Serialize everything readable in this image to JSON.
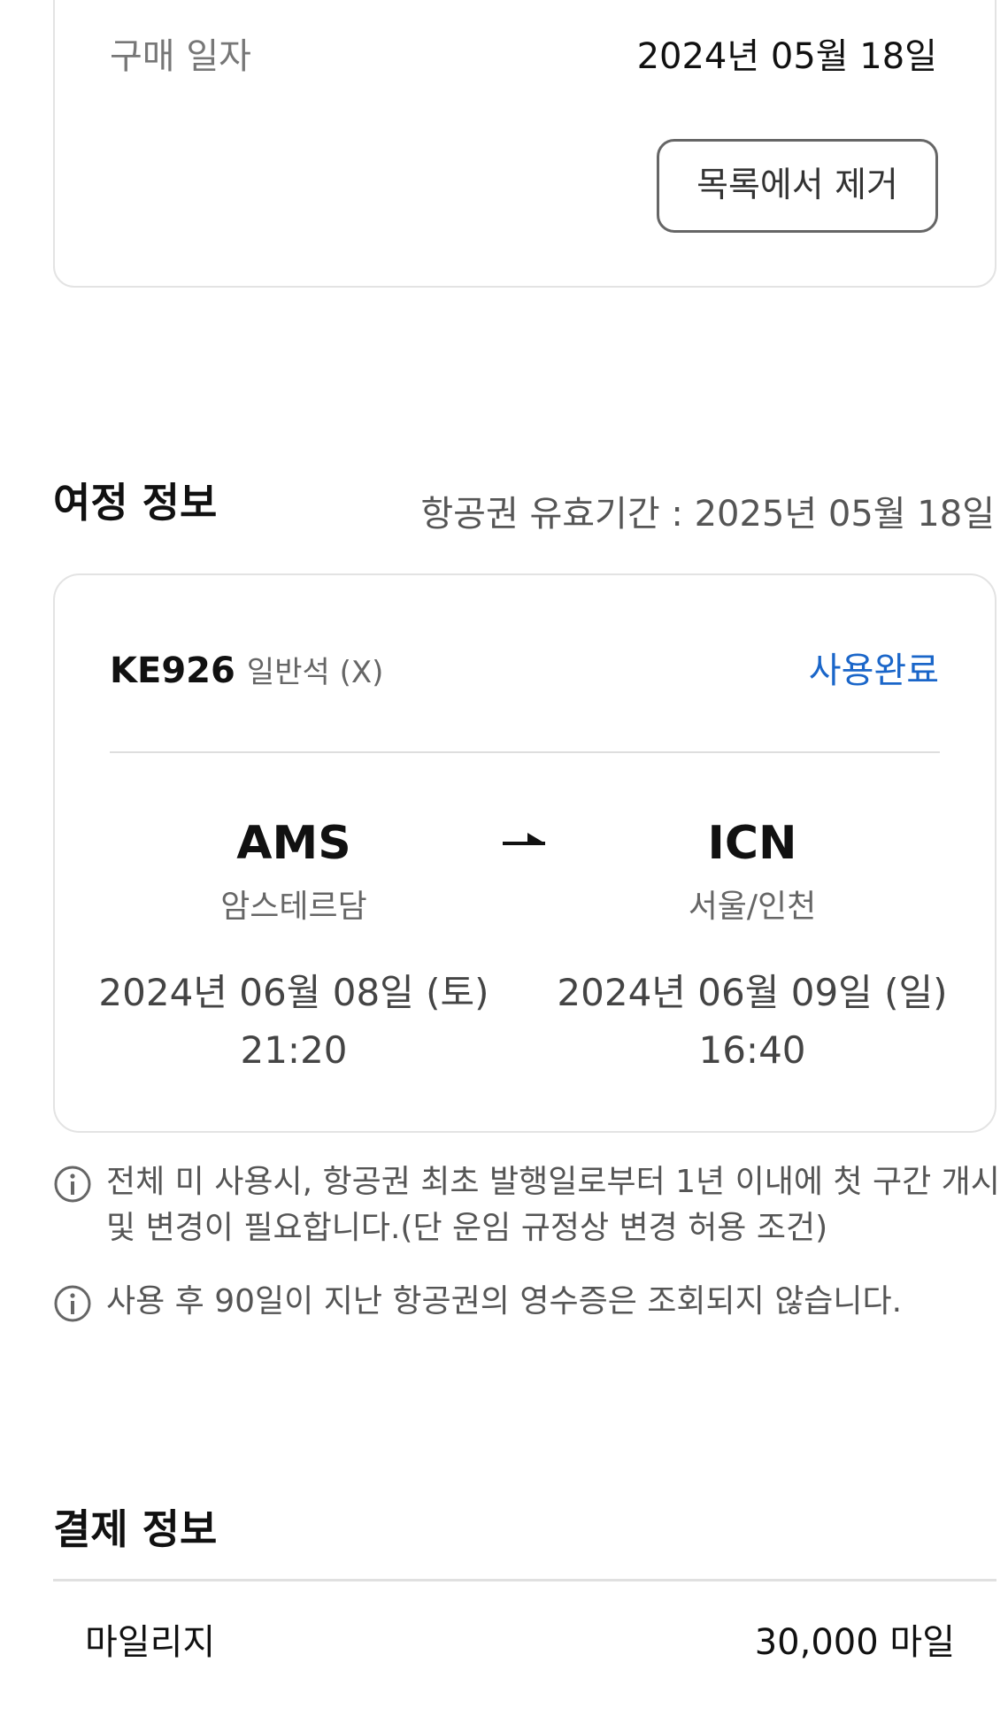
{
  "purchase": {
    "label": "구매 일자",
    "value": "2024년 05월 18일",
    "remove_button": "목록에서 제거"
  },
  "itinerary": {
    "title": "여정 정보",
    "validity": "항공권 유효기간 : 2025년 05월 18일",
    "flight_number": "KE926",
    "cabin": "일반석 (X)",
    "status": "사용완료",
    "status_color": "#1a66c9",
    "departure": {
      "code": "AMS",
      "city": "암스테르담",
      "date": "2024년 06월 08일 (토)",
      "time": "21:20"
    },
    "arrival": {
      "code": "ICN",
      "city": "서울/인천",
      "date": "2024년 06월 09일 (일)",
      "time": "16:40"
    },
    "notices": [
      "전체 미 사용시, 항공권 최초 발행일로부터 1년 이내에 첫 구간 개시 및 변경이 필요합니다.(단 운임 규정상 변경 허용 조건)",
      "사용 후 90일이 지난 항공권의 영수증은 조회되지 않습니다."
    ]
  },
  "payment": {
    "title": "결제 정보",
    "mileage_label": "마일리지",
    "mileage_value": "30,000 마일"
  }
}
